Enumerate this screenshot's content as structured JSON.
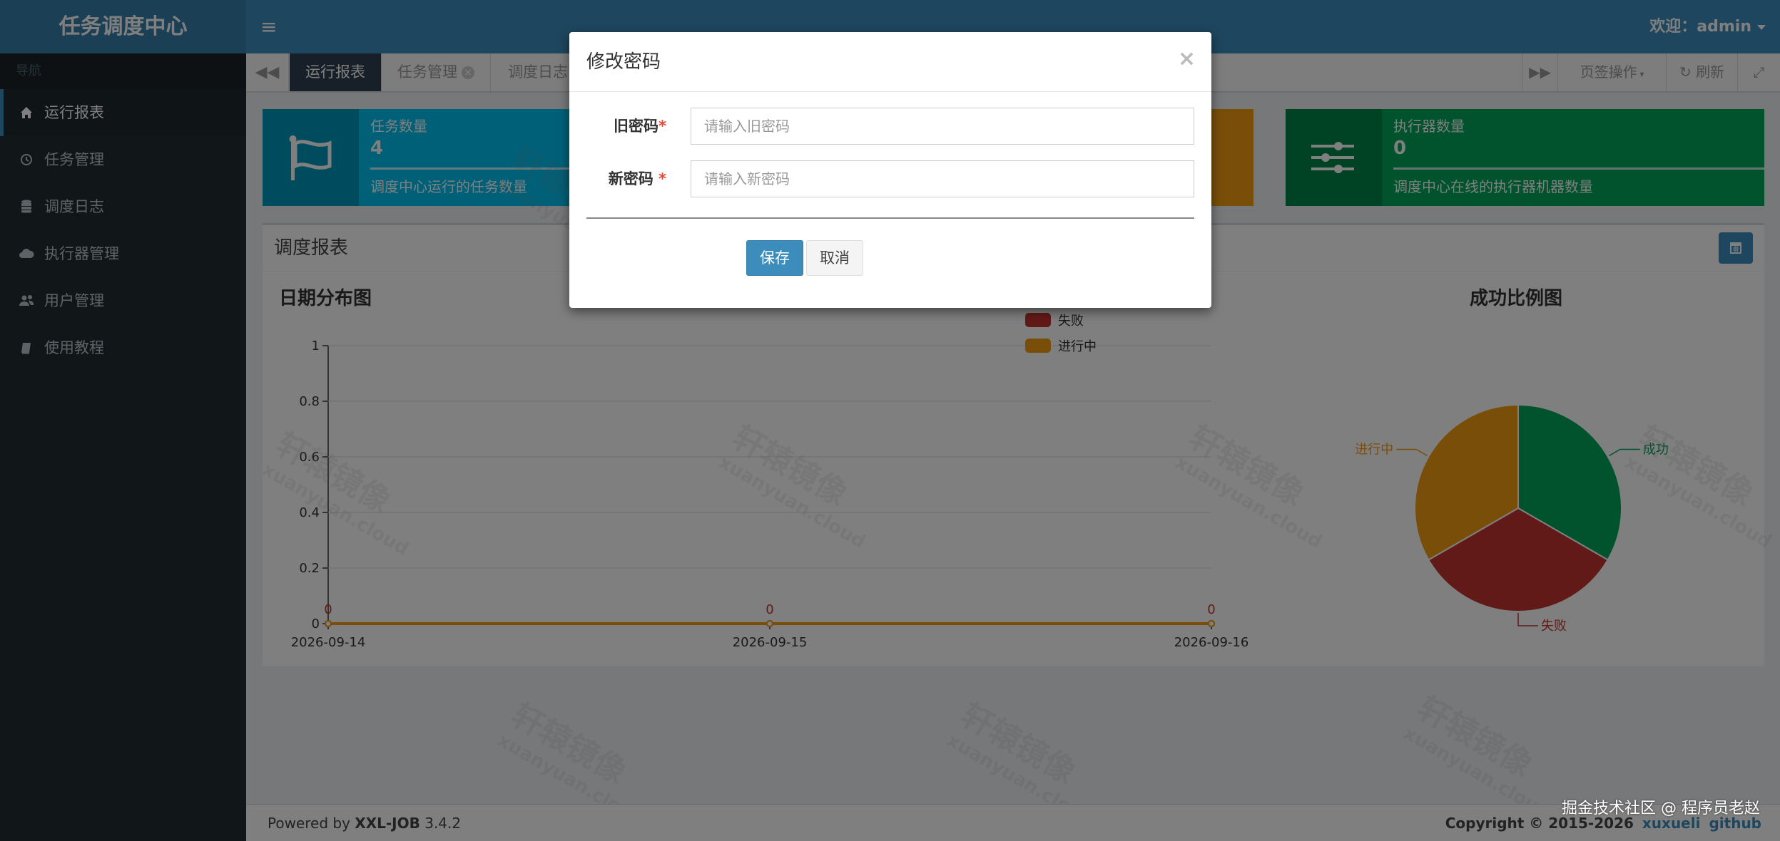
{
  "app": {
    "logo": "任务调度中心",
    "welcome": "欢迎：admin"
  },
  "sidebar": {
    "header": "导航",
    "items": [
      {
        "label": "运行报表",
        "icon": "home-icon",
        "active": true
      },
      {
        "label": "任务管理",
        "icon": "clock-icon"
      },
      {
        "label": "调度日志",
        "icon": "database-icon"
      },
      {
        "label": "执行器管理",
        "icon": "cloud-icon"
      },
      {
        "label": "用户管理",
        "icon": "users-icon"
      },
      {
        "label": "使用教程",
        "icon": "book-icon"
      }
    ]
  },
  "tabs": {
    "items": [
      {
        "label": "运行报表",
        "active": true
      },
      {
        "label": "任务管理",
        "closable": true
      },
      {
        "label": "调度日志"
      }
    ],
    "page_ops": "页签操作",
    "refresh": "刷新"
  },
  "info_boxes": [
    {
      "title": "任务数量",
      "number": "4",
      "desc": "调度中心运行的任务数量",
      "color": "#00c0ef"
    },
    {
      "title": "执行器数量",
      "number": "0",
      "desc": "调度中心在线的执行器机器数量",
      "color": "#00a65a"
    }
  ],
  "report": {
    "title": "调度报表",
    "line_title": "日期分布图",
    "pie_title": "成功比例图"
  },
  "chart_data": [
    {
      "type": "line",
      "title": "日期分布图",
      "x": [
        "2026-09-14",
        "2026-09-15",
        "2026-09-16"
      ],
      "yticks": [
        "0",
        "0.2",
        "0.4",
        "0.6",
        "0.8",
        "1"
      ],
      "ylim": [
        0,
        1
      ],
      "series": [
        {
          "name": "成功",
          "values": [
            0,
            0,
            0
          ],
          "color": "#00a65a"
        },
        {
          "name": "失败",
          "values": [
            0,
            0,
            0
          ],
          "color": "#c23531"
        },
        {
          "name": "进行中",
          "values": [
            0,
            0,
            0
          ],
          "color": "#f39c12"
        }
      ],
      "data_labels": [
        "0",
        "0",
        "0"
      ],
      "legend": "top-right"
    },
    {
      "type": "pie",
      "title": "成功比例图",
      "slices": [
        {
          "name": "成功",
          "value": 1,
          "color": "#00a65a"
        },
        {
          "name": "失败",
          "value": 1,
          "color": "#c23531"
        },
        {
          "name": "进行中",
          "value": 1,
          "color": "#f39c12"
        }
      ]
    }
  ],
  "modal": {
    "title": "修改密码",
    "close": "×",
    "old_label": "旧密码",
    "old_placeholder": "请输入旧密码",
    "new_label": "新密码",
    "new_placeholder": "请输入新密码",
    "required_mark": "*",
    "save": "保存",
    "cancel": "取消"
  },
  "footer": {
    "powered_prefix": "Powered by ",
    "powered_brand": "XXL-JOB",
    "powered_version": " 3.4.2",
    "copyright": "Copyright © 2015-2026",
    "link1": "xuxueli",
    "link2": "github"
  },
  "attribution": "掘金技术社区 @ 程序员老赵",
  "watermark": {
    "line1": "轩辕镜像",
    "line2": "xuanyuan.cloud"
  }
}
